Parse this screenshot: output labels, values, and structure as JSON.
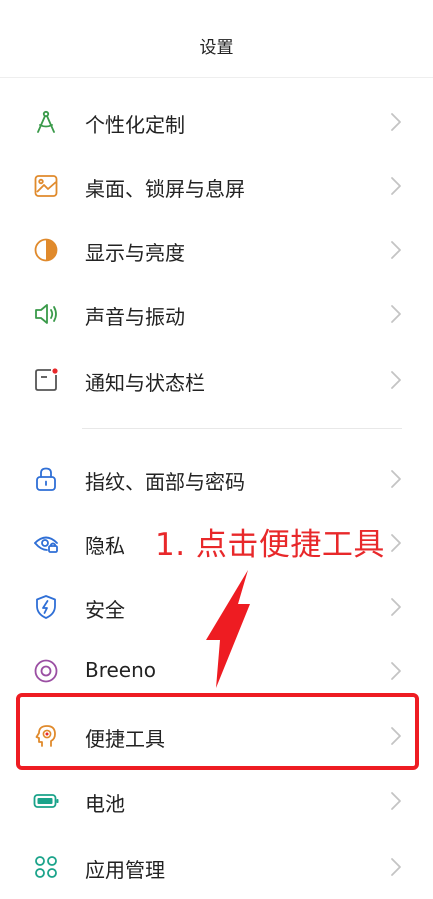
{
  "header": {
    "title": "设置"
  },
  "items": [
    {
      "label": "个性化定制",
      "icon": "compass-icon"
    },
    {
      "label": "桌面、锁屏与息屏",
      "icon": "wallpaper-icon"
    },
    {
      "label": "显示与亮度",
      "icon": "brightness-icon"
    },
    {
      "label": "声音与振动",
      "icon": "speaker-icon"
    },
    {
      "label": "通知与状态栏",
      "icon": "notification-icon"
    },
    {
      "label": "指纹、面部与密码",
      "icon": "lock-icon"
    },
    {
      "label": "隐私",
      "icon": "privacy-eye-icon"
    },
    {
      "label": "安全",
      "icon": "shield-icon"
    },
    {
      "label": "Breeno",
      "icon": "breeno-icon"
    },
    {
      "label": "便捷工具",
      "icon": "convenience-tools-icon"
    },
    {
      "label": "电池",
      "icon": "battery-icon"
    },
    {
      "label": "应用管理",
      "icon": "apps-icon"
    }
  ],
  "annotation": {
    "text": "1. 点击便捷工具"
  },
  "colors": {
    "green": "#3a9a4a",
    "orange": "#e08a2c",
    "blue": "#2f6fd6",
    "purple": "#9b4fa3",
    "teal": "#1aa38a",
    "annotation_red": "#e8282a"
  }
}
